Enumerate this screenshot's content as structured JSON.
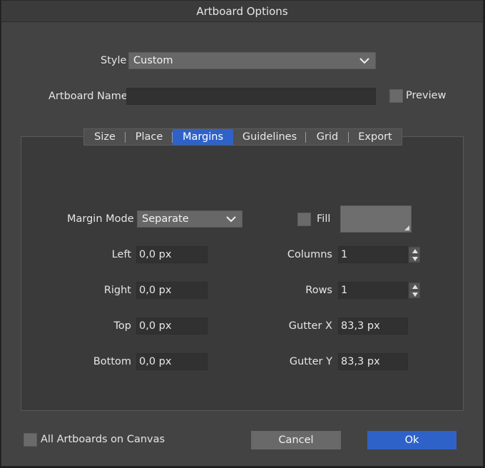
{
  "dialog": {
    "title": "Artboard Options"
  },
  "top": {
    "style_label": "Style",
    "style_value": "Custom",
    "name_label": "Artboard Name",
    "name_value": "",
    "preview_label": "Preview"
  },
  "tabs": [
    {
      "label": "Size"
    },
    {
      "label": "Place"
    },
    {
      "label": "Margins",
      "active": true
    },
    {
      "label": "Guidelines"
    },
    {
      "label": "Grid"
    },
    {
      "label": "Export"
    }
  ],
  "margins": {
    "mode_label": "Margin Mode",
    "mode_value": "Separate",
    "left_label": "Left",
    "left_value": "0,0 px",
    "right_label": "Right",
    "right_value": "0,0 px",
    "top_label": "Top",
    "top_value": "0,0 px",
    "bottom_label": "Bottom",
    "bottom_value": "0,0 px",
    "fill_label": "Fill",
    "columns_label": "Columns",
    "columns_value": "1",
    "rows_label": "Rows",
    "rows_value": "1",
    "gutter_x_label": "Gutter X",
    "gutter_x_value": "83,3 px",
    "gutter_y_label": "Gutter Y",
    "gutter_y_value": "83,3 px"
  },
  "footer": {
    "all_artboards_label": "All Artboards on Canvas",
    "cancel_label": "Cancel",
    "ok_label": "Ok"
  },
  "colors": {
    "accent": "#2f62c8",
    "dialog_bg": "#434343",
    "panel_bg": "#3a3a3a",
    "field_bg": "#313131"
  },
  "icons": [
    "chevron-down-icon",
    "spinner-up-icon",
    "spinner-down-icon",
    "resize-corner-icon"
  ]
}
